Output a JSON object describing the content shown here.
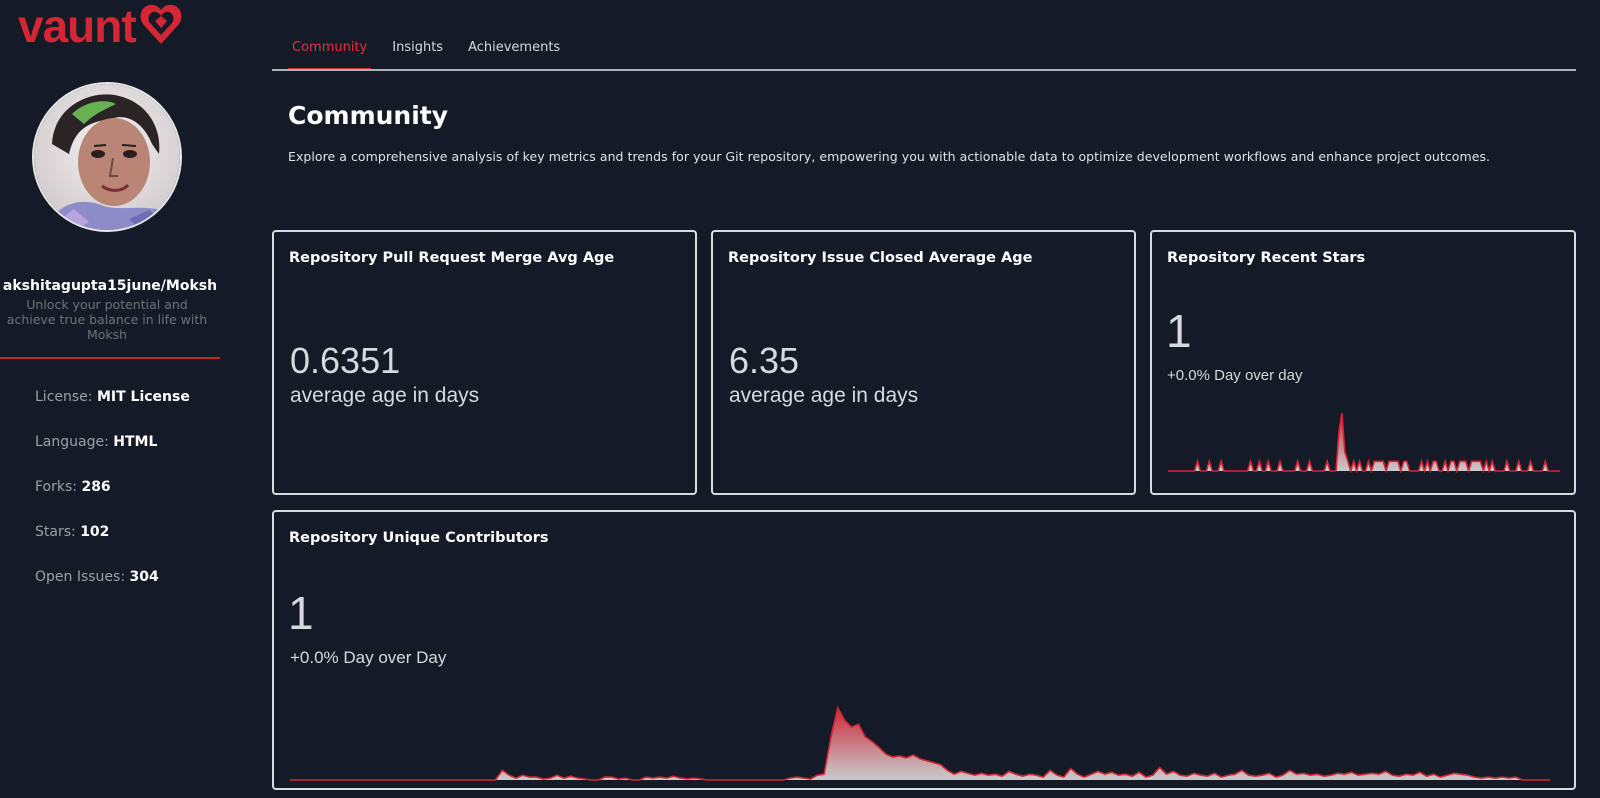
{
  "brand": {
    "name": "vaunt",
    "color": "#d42634"
  },
  "profile": {
    "username": "akshitagupta15june/Moksh",
    "tagline": "Unlock your potential and achieve true balance in life with Moksh"
  },
  "stats": [
    {
      "label": "License:",
      "value": "MIT License"
    },
    {
      "label": "Language:",
      "value": "HTML"
    },
    {
      "label": "Forks:",
      "value": "286"
    },
    {
      "label": "Stars:",
      "value": "102"
    },
    {
      "label": "Open Issues:",
      "value": "304"
    }
  ],
  "tabs": [
    {
      "label": "Community",
      "active": true
    },
    {
      "label": "Insights",
      "active": false
    },
    {
      "label": "Achievements",
      "active": false
    }
  ],
  "page": {
    "title": "Community",
    "description": "Explore a comprehensive analysis of key metrics and trends for your Git repository, empowering you with actionable data to optimize development workflows and enhance project outcomes."
  },
  "cards": {
    "pr_merge": {
      "title": "Repository Pull Request Merge Avg Age",
      "value": "0.6351",
      "label": "average age in days"
    },
    "issue_closed": {
      "title": "Repository Issue Closed Average Age",
      "value": "6.35",
      "label": "average age in days"
    },
    "recent_stars": {
      "title": "Repository Recent Stars",
      "value": "1",
      "label": "+0.0% Day over day"
    },
    "contributors": {
      "title": "Repository Unique Contributors",
      "value": "1",
      "label": "+0.0% Day over Day"
    }
  },
  "colors": {
    "accent": "#d42634",
    "background": "#141b26",
    "card_border": "#d9dce0"
  },
  "chart_data": [
    {
      "type": "area",
      "series": [
        {
          "values": [
            0,
            0,
            0,
            0,
            0,
            0,
            0,
            0,
            0,
            0,
            1,
            0,
            0,
            0,
            1,
            0,
            0,
            0,
            1,
            0,
            0,
            0,
            0,
            0,
            0,
            0,
            0,
            0,
            1,
            0,
            0,
            1,
            0,
            0,
            1,
            0,
            0,
            0,
            1,
            0,
            0,
            0,
            0,
            0,
            1,
            0,
            0,
            0,
            1,
            0,
            0,
            0,
            0,
            0,
            1,
            0,
            0,
            0,
            4,
            6,
            2,
            1,
            0,
            1,
            0,
            1,
            0,
            0,
            1,
            0,
            1,
            1,
            1,
            1,
            0,
            1,
            1,
            1,
            1,
            0,
            1,
            1,
            0,
            0,
            0,
            0,
            1,
            0,
            1,
            0,
            1,
            1,
            0,
            0,
            1,
            0,
            1,
            1,
            0,
            1,
            1,
            1,
            0,
            1,
            1,
            1,
            1,
            0,
            1,
            0,
            1,
            0,
            0,
            0,
            0,
            1,
            0,
            0,
            0,
            1,
            0,
            0,
            0,
            1,
            0,
            0,
            0,
            0,
            1,
            0,
            0,
            0,
            0,
            0
          ]
        }
      ]
    },
    {
      "type": "area",
      "series": [
        {
          "values": [
            0,
            0,
            0,
            0,
            0,
            0,
            0,
            0,
            0,
            0,
            0,
            0,
            0,
            0,
            0,
            0,
            0,
            0,
            0,
            0,
            0,
            0,
            0,
            0,
            0,
            0,
            0,
            0,
            0,
            0,
            0,
            1,
            0.5,
            0.2,
            0.5,
            0.3,
            0.3,
            0.1,
            0.2,
            0.5,
            0.2,
            0.4,
            0.2,
            0.1,
            0,
            0,
            0.3,
            0.3,
            0.1,
            0.2,
            0,
            0,
            0.3,
            0.2,
            0.3,
            0.2,
            0.4,
            0.2,
            0.1,
            0.2,
            0.1,
            0,
            0,
            0,
            0,
            0,
            0,
            0,
            0,
            0,
            0,
            0,
            0,
            0.2,
            0.3,
            0.2,
            0.1,
            0.5,
            0.6,
            4.5,
            7.5,
            6.2,
            5.5,
            5.8,
            4.5,
            4.0,
            3.4,
            2.7,
            2.4,
            2.5,
            2.3,
            2.6,
            2.2,
            2.0,
            1.8,
            1.6,
            1.0,
            0.6,
            0.9,
            0.7,
            0.5,
            0.7,
            0.5,
            0.6,
            0.4,
            0.9,
            0.6,
            0.4,
            0.6,
            0.5,
            0.3,
            1.0,
            0.5,
            0.3,
            1.2,
            0.6,
            0.3,
            0.6,
            0.9,
            0.6,
            0.8,
            0.5,
            0.6,
            0.4,
            0.8,
            0.3,
            0.5,
            1.3,
            0.6,
            0.9,
            0.5,
            0.4,
            0.7,
            0.5,
            0.4,
            0.7,
            0.3,
            0.5,
            0.6,
            1.0,
            0.5,
            0.4,
            0.5,
            0.7,
            0.3,
            0.5,
            1.0,
            0.6,
            0.7,
            0.5,
            0.6,
            0.4,
            0.5,
            0.7,
            0.6,
            0.8,
            0.5,
            0.6,
            0.7,
            0.6,
            0.9,
            0.5,
            0.4,
            0.6,
            0.5,
            0.8,
            0.4,
            0.6,
            0.3,
            0.5,
            0.7,
            0.6,
            0.5,
            0.3,
            0.2,
            0.3,
            0.2,
            0.3,
            0.2,
            0.3,
            0,
            0,
            0,
            0,
            0
          ]
        }
      ]
    }
  ]
}
